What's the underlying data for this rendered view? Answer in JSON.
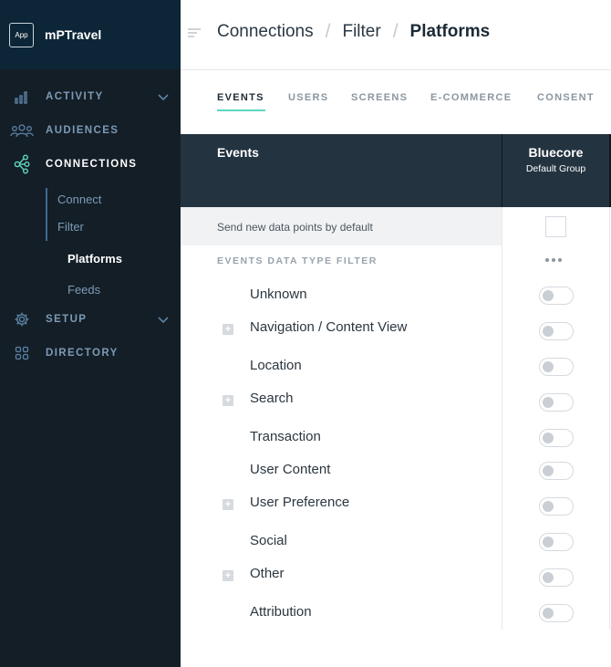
{
  "brand": {
    "badge": "App",
    "name": "mPTravel"
  },
  "sidebar": {
    "items": [
      {
        "label": "ACTIVITY",
        "icon": "bar-chart-icon",
        "chevron": true
      },
      {
        "label": "AUDIENCES",
        "icon": "users-icon",
        "chevron": false
      },
      {
        "label": "CONNECTIONS",
        "icon": "connections-icon",
        "chevron": false,
        "active": true
      },
      {
        "label": "SETUP",
        "icon": "gear-icon",
        "chevron": true
      },
      {
        "label": "DIRECTORY",
        "icon": "grid-icon",
        "chevron": false
      }
    ],
    "subitems": [
      "Connect",
      "Filter",
      "Platforms",
      "Feeds"
    ],
    "active_subitem": "Platforms"
  },
  "breadcrumb": {
    "items": [
      "Connections",
      "Filter",
      "Platforms"
    ]
  },
  "tabs": [
    "EVENTS",
    "USERS",
    "SCREENS",
    "E-COMMERCE",
    "CONSENT"
  ],
  "active_tab": "EVENTS",
  "table": {
    "first_column_header": "Events",
    "platform": {
      "name": "Bluecore",
      "group": "Default Group"
    },
    "default_row_label": "Send new data points by default",
    "default_checked": false,
    "filter_section_title": "EVENTS DATA TYPE FILTER",
    "rows": [
      {
        "label": "Unknown",
        "expandable": false,
        "enabled": false
      },
      {
        "label": "Navigation / Content View",
        "expandable": true,
        "enabled": false
      },
      {
        "label": "Location",
        "expandable": false,
        "enabled": false
      },
      {
        "label": "Search",
        "expandable": true,
        "enabled": false
      },
      {
        "label": "Transaction",
        "expandable": false,
        "enabled": false
      },
      {
        "label": "User Content",
        "expandable": false,
        "enabled": false
      },
      {
        "label": "User Preference",
        "expandable": true,
        "enabled": false
      },
      {
        "label": "Social",
        "expandable": false,
        "enabled": false
      },
      {
        "label": "Other",
        "expandable": true,
        "enabled": false
      },
      {
        "label": "Attribution",
        "expandable": false,
        "enabled": false
      }
    ]
  },
  "colors": {
    "sidebar_bg": "#141e27",
    "brand_bg": "#0c2637",
    "accent": "#5ed7c0",
    "table_header_bg": "#243340"
  }
}
